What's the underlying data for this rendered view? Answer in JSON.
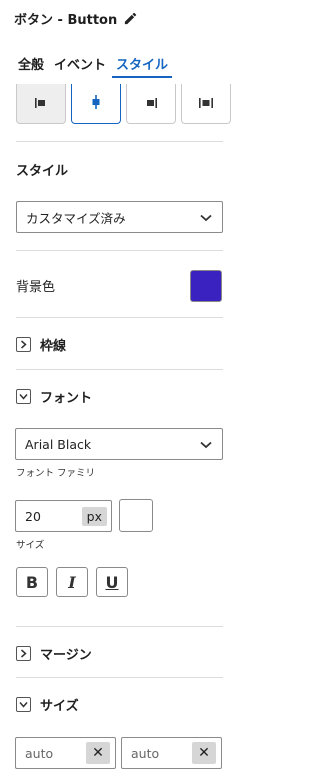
{
  "header": {
    "title": "ボタン - Button",
    "edit_icon": "pencil-icon"
  },
  "tabs": [
    {
      "label": "全般",
      "active": false
    },
    {
      "label": "イベント",
      "active": false
    },
    {
      "label": "スタイル",
      "active": true
    }
  ],
  "alignment": {
    "options": [
      "align-left-icon",
      "align-center-icon",
      "align-right-icon",
      "align-justify-icon"
    ],
    "selected_index": 1
  },
  "style_section": {
    "label": "スタイル",
    "value": "カスタマイズ済み"
  },
  "background": {
    "label": "背景色",
    "color": "#3a22c0"
  },
  "border_section": {
    "label": "枠線",
    "expanded": false
  },
  "font_section": {
    "label": "フォント",
    "expanded": true,
    "family_value": "Arial Black",
    "family_caption": "フォント ファミリ",
    "size_value": "20",
    "size_unit": "px",
    "size_caption": "サイズ",
    "bold_label": "B",
    "italic_label": "I",
    "underline_label": "U"
  },
  "margin_section": {
    "label": "マージン",
    "expanded": false
  },
  "size_section": {
    "label": "サイズ",
    "expanded": true,
    "width_value": "auto",
    "height_value": "auto",
    "clear_label": "✕"
  },
  "colors": {
    "accent": "#1565c0"
  }
}
